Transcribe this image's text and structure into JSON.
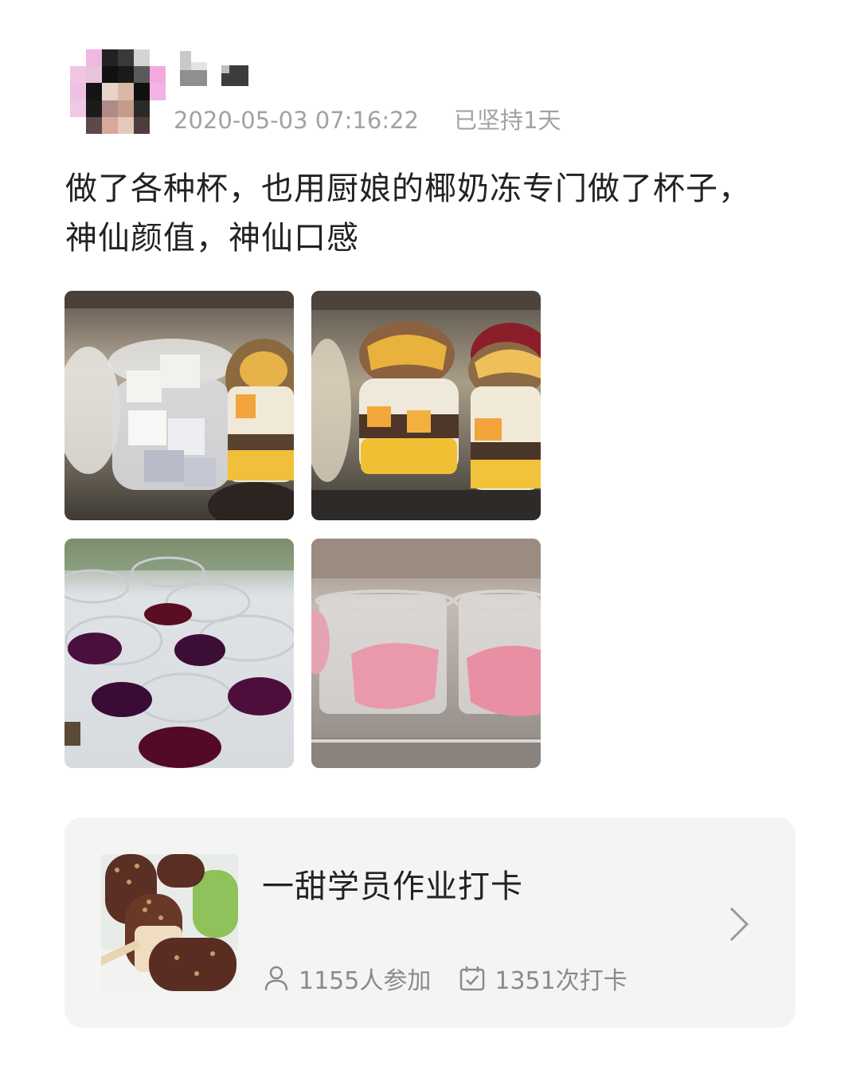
{
  "post": {
    "timestamp": "2020-05-03 07:16:22",
    "streak": "已坚持1天",
    "text": "做了各种杯，也用厨娘的椰奶冻专门做了杯子，神仙颜值，神仙口感"
  },
  "photos": [
    {
      "icon": "photo-dessert-cups-coconut-jelly"
    },
    {
      "icon": "photo-dessert-cups-mango"
    },
    {
      "icon": "photo-jelly-cups-purple"
    },
    {
      "icon": "photo-mousse-cups-pink"
    }
  ],
  "checkin_card": {
    "title": "一甜学员作业打卡",
    "participants": "1155人参加",
    "checkins": "1351次打卡",
    "thumb_icon": "popsicle-thumbnail",
    "participants_icon": "person-icon",
    "checkins_icon": "calendar-check-icon",
    "arrow_icon": "chevron-right-icon"
  },
  "colors": {
    "meta_text": "#a2a2a2",
    "card_bg": "#f4f4f4",
    "stat_text": "#8a8a8a"
  }
}
